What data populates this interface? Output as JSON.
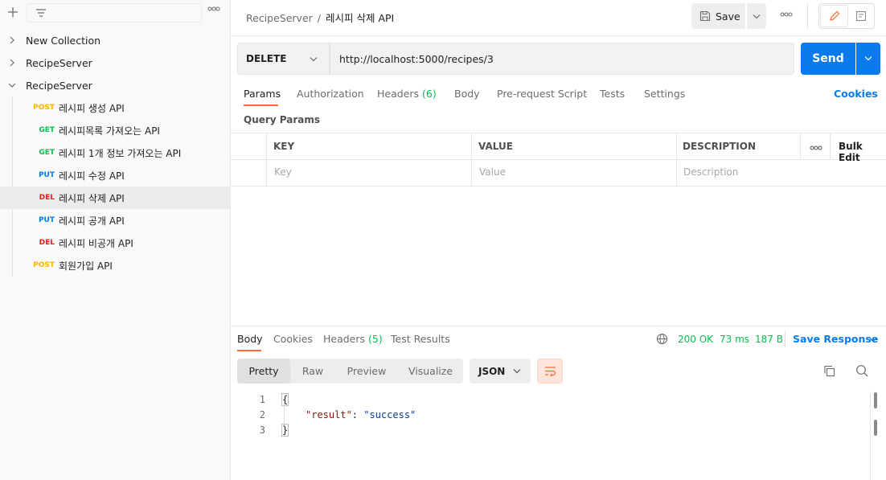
{
  "sidebar": {
    "collections": [
      {
        "name": "New Collection",
        "expanded": false
      },
      {
        "name": "RecipeServer",
        "expanded": false
      },
      {
        "name": "RecipeServer",
        "expanded": true
      }
    ],
    "requests": [
      {
        "method": "POST",
        "name": "레시피 생성 API",
        "level": 1
      },
      {
        "method": "GET",
        "name": "레시피목록 가져오는 API",
        "level": 2
      },
      {
        "method": "GET",
        "name": "레시피 1개 정보 가져오는 API",
        "level": 2
      },
      {
        "method": "PUT",
        "name": "레시피 수정 API",
        "level": 2
      },
      {
        "method": "DEL",
        "name": "레시피 삭제 API",
        "level": 2,
        "selected": true
      },
      {
        "method": "PUT",
        "name": "레시피 공개 API",
        "level": 2
      },
      {
        "method": "DEL",
        "name": "레시피 비공개 API",
        "level": 2
      },
      {
        "method": "POST",
        "name": "회원가입 API",
        "level": 1
      }
    ]
  },
  "header": {
    "breadcrumb_parent": "RecipeServer",
    "breadcrumb_sep": "/",
    "breadcrumb_current": "레시피 삭제 API",
    "save_label": "Save"
  },
  "request": {
    "method": "DELETE",
    "url": "http://localhost:5000/recipes/3",
    "send_label": "Send"
  },
  "tabs": {
    "params": "Params",
    "authorization": "Authorization",
    "headers": "Headers",
    "headers_count": "(6)",
    "body": "Body",
    "prerequest": "Pre-request Script",
    "tests": "Tests",
    "settings": "Settings",
    "cookies": "Cookies"
  },
  "query_params": {
    "title": "Query Params",
    "headers": {
      "key": "KEY",
      "value": "VALUE",
      "description": "DESCRIPTION",
      "bulk_edit": "Bulk Edit"
    },
    "placeholders": {
      "key": "Key",
      "value": "Value",
      "description": "Description"
    }
  },
  "response": {
    "tabs": {
      "body": "Body",
      "cookies": "Cookies",
      "headers": "Headers",
      "headers_count": "(5)",
      "test_results": "Test Results"
    },
    "status": "200 OK",
    "time": "73 ms",
    "size": "187 B",
    "save_response": "Save Response",
    "views": {
      "pretty": "Pretty",
      "raw": "Raw",
      "preview": "Preview",
      "visualize": "Visualize"
    },
    "format": "JSON",
    "lines": [
      {
        "num": "1",
        "open": "{"
      },
      {
        "num": "2",
        "key": "\"result\"",
        "colon": ": ",
        "value": "\"success\""
      },
      {
        "num": "3",
        "close": "}"
      }
    ]
  },
  "colors": {
    "accent": "#ff6c37",
    "send": "#097bed",
    "post": "#ffb400",
    "get": "#0cbb52",
    "put": "#097bed",
    "del": "#eb2013",
    "status_ok": "#0cbb52"
  }
}
